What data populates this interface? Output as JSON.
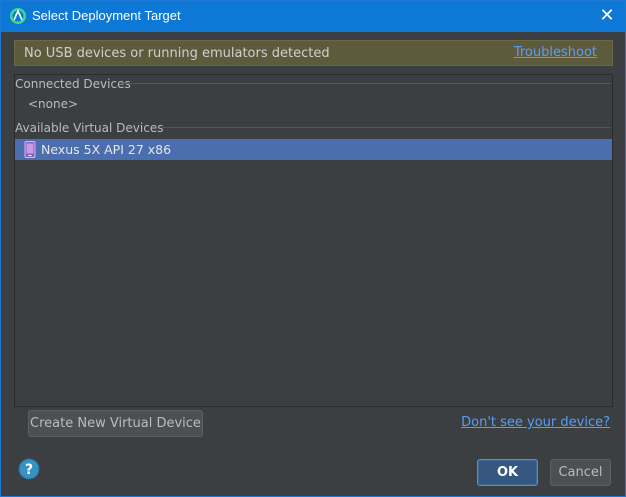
{
  "window": {
    "title": "Select Deployment Target",
    "app_icon": "android-studio-icon",
    "close_icon": "close-icon"
  },
  "banner": {
    "message": "No USB devices or running emulators detected",
    "link": "Troubleshoot"
  },
  "sections": {
    "connected": {
      "header": "Connected Devices",
      "empty_text": "<none>"
    },
    "available": {
      "header": "Available Virtual Devices",
      "devices": [
        {
          "label": "Nexus 5X API 27 x86",
          "icon": "phone-icon",
          "selected": true
        }
      ]
    }
  },
  "footer": {
    "create_button": "Create New Virtual Device",
    "dont_see_link": "Don't see your device?",
    "help_icon": "help-icon",
    "ok_button": "OK",
    "cancel_button": "Cancel"
  },
  "colors": {
    "titlebar": "#0e78d7",
    "background": "#3c3f41",
    "banner": "#5e5b3d",
    "selection": "#4b6eaf",
    "link": "#589df6"
  }
}
